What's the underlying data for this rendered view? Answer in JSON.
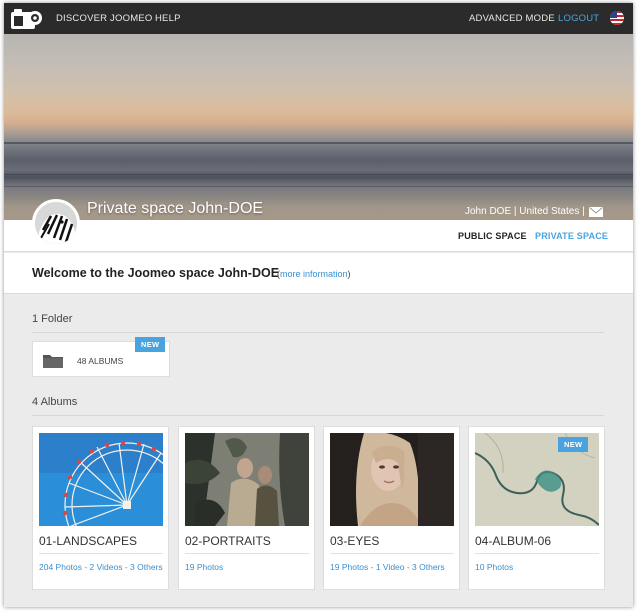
{
  "nav": {
    "discover": "DISCOVER JOOMEO",
    "help": "HELP",
    "advanced": "ADVANCED MODE",
    "logout": "LOGOUT",
    "flag_icon": "us-flag-icon"
  },
  "hero": {
    "title": "Private space John-DOE",
    "user_info": "John DOE | United States |",
    "mail_icon": "mail-icon"
  },
  "tabs": {
    "public": "PUBLIC SPACE",
    "private": "PRIVATE SPACE"
  },
  "welcome": {
    "text": "Welcome to the Joomeo space John-DOE",
    "more_open": "(",
    "more_link": "more information",
    "more_close": ")"
  },
  "folders": {
    "heading": "1 Folder",
    "items": [
      {
        "label": "48 ALBUMS",
        "badge": "NEW",
        "icon": "folder-icon"
      }
    ]
  },
  "albums": {
    "heading": "4 Albums",
    "items": [
      {
        "title": "01-LANDSCAPES",
        "meta": "204 Photos - 2 Videos - 3 Others",
        "badge": ""
      },
      {
        "title": "02-PORTRAITS",
        "meta": "19 Photos",
        "badge": ""
      },
      {
        "title": "03-EYES",
        "meta": "19 Photos - 1 Video - 3 Others",
        "badge": ""
      },
      {
        "title": "04-ALBUM-06",
        "meta": "10 Photos",
        "badge": "NEW"
      }
    ]
  },
  "colors": {
    "accent": "#4aa3df",
    "topbar": "#2b2b2b",
    "page_bg": "#ebebeb"
  }
}
